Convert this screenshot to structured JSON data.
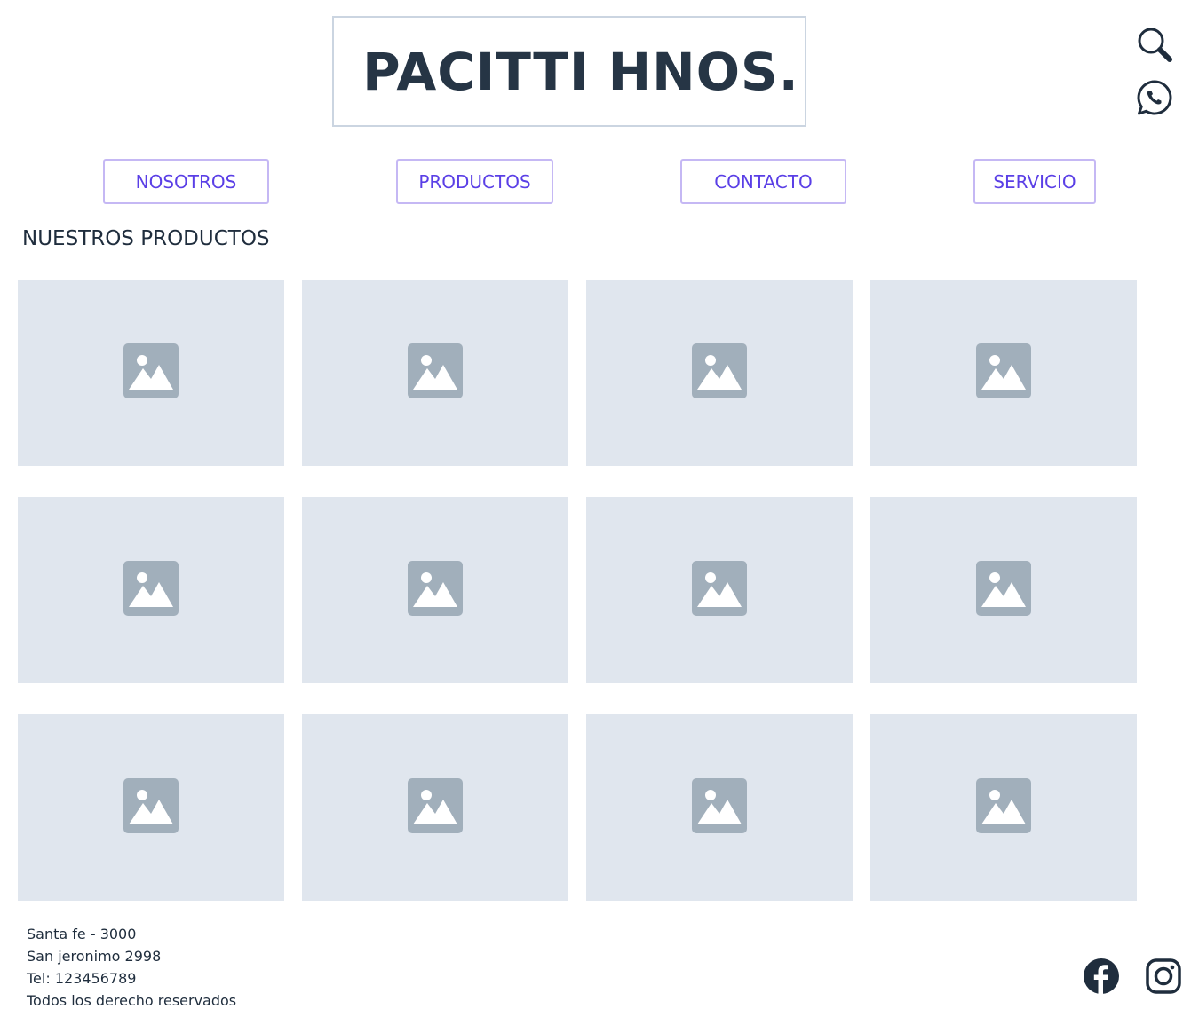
{
  "header": {
    "logo_text": "PACITTI HNOS.",
    "icons": [
      "search-icon",
      "whatsapp-icon"
    ]
  },
  "nav": {
    "items": [
      {
        "label": "NOSOTROS"
      },
      {
        "label": "PRODUCTOS"
      },
      {
        "label": "CONTACTO"
      },
      {
        "label": "SERVICIO"
      }
    ]
  },
  "products": {
    "title": "NUESTROS PRODUCTOS",
    "count": 12,
    "placeholder_icon": "image-placeholder-icon"
  },
  "footer": {
    "lines": [
      "Santa fe - 3000",
      "San jeronimo 2998",
      "Tel: 123456789",
      "Todos los derecho reservados"
    ],
    "social_icons": [
      "facebook-icon",
      "instagram-icon"
    ]
  },
  "colors": {
    "nav_accent": "#5a3fe6",
    "nav_border": "#c5b8f4",
    "placeholder_bg": "#e0e6ee",
    "placeholder_icon": "#a1afbb",
    "logo_text": "#263545"
  }
}
